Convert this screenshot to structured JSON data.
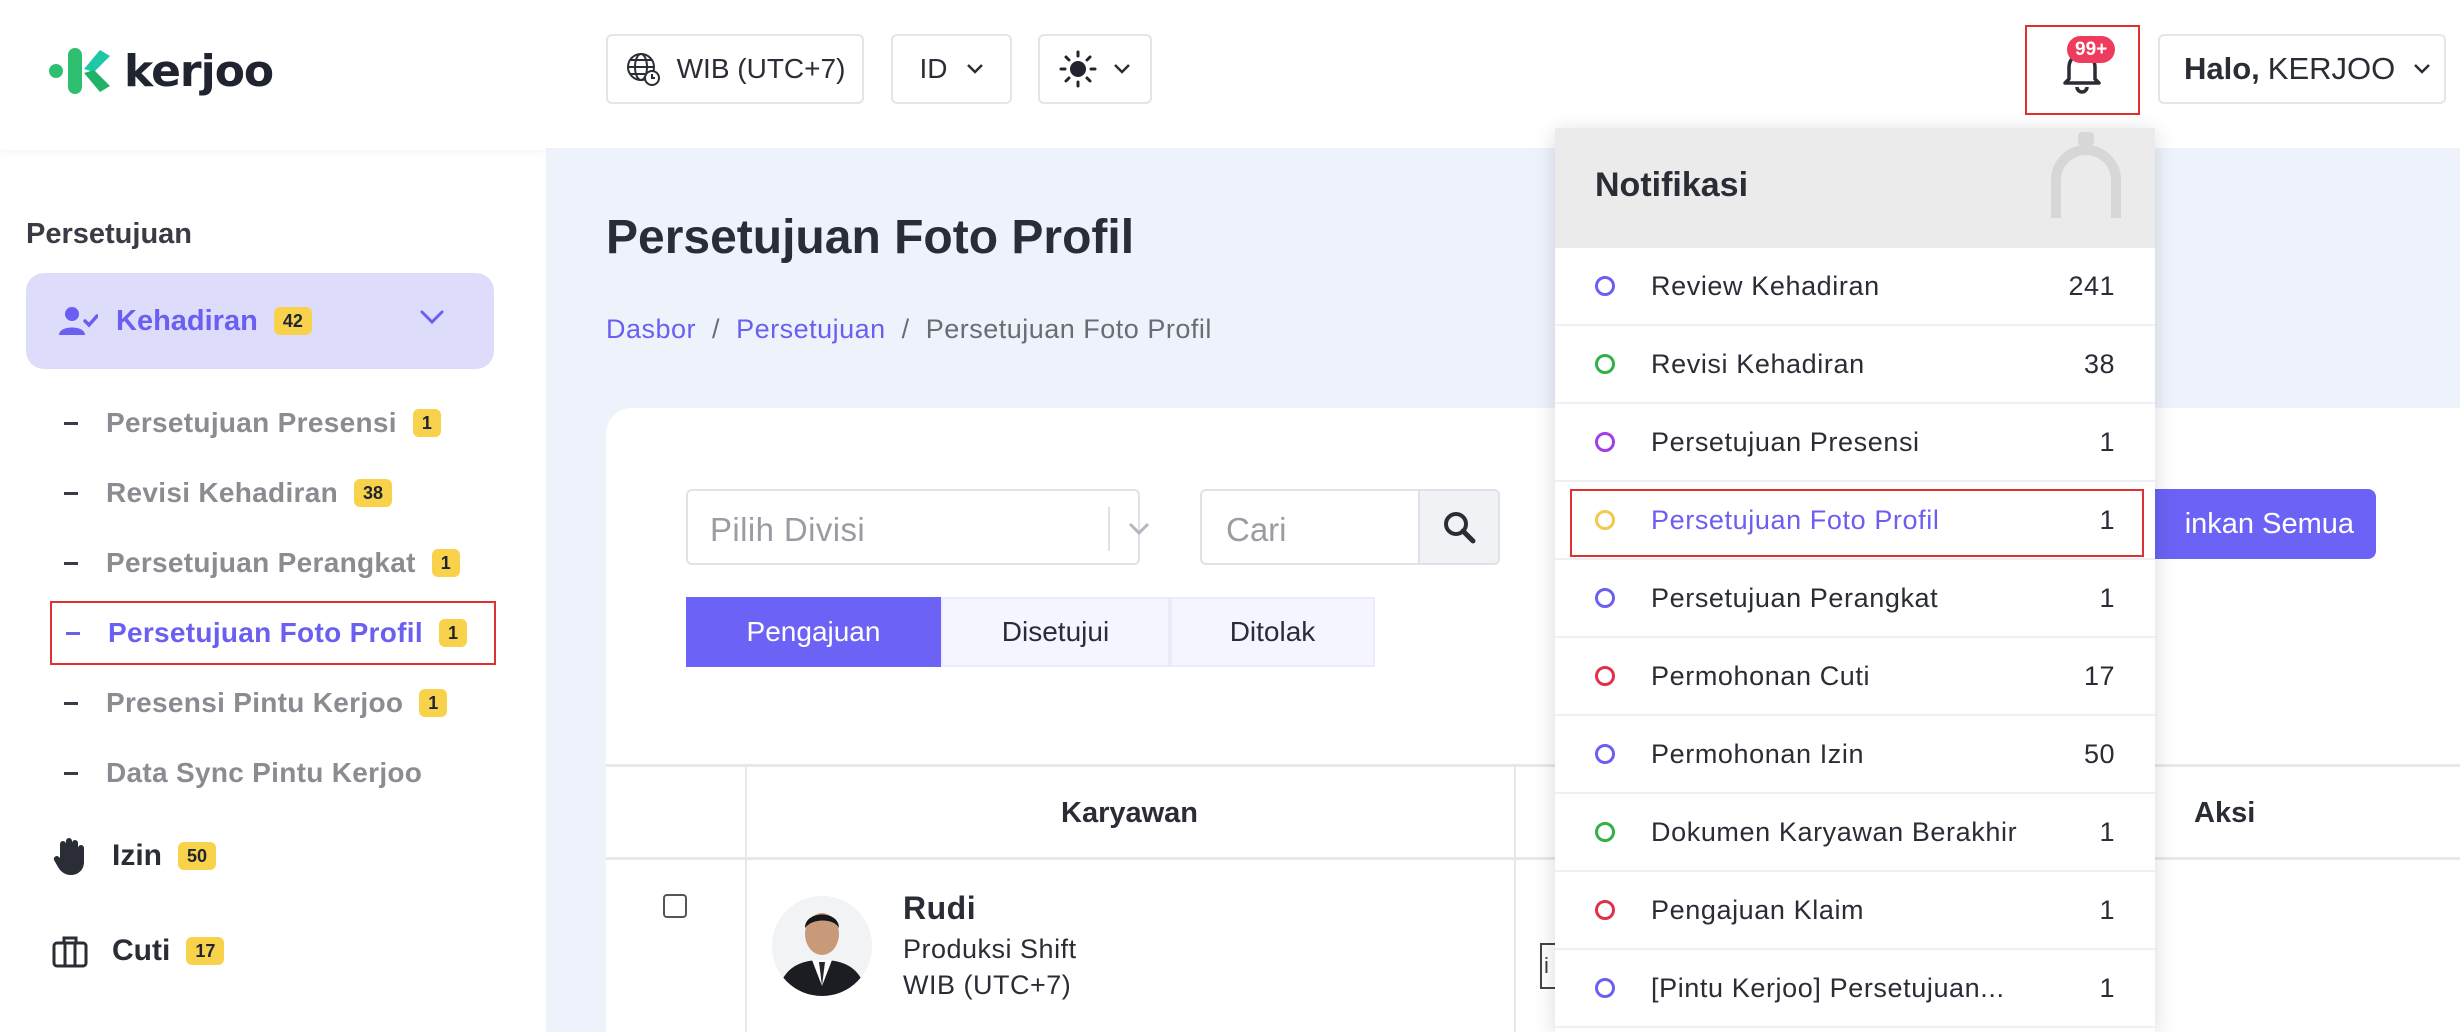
{
  "brand": {
    "name": "kerjoo"
  },
  "sidebar": {
    "section_title": "Persetujuan",
    "group": {
      "label": "Kehadiran",
      "badge": "42"
    },
    "subitems": [
      {
        "label": "Persetujuan Presensi",
        "badge": "1"
      },
      {
        "label": "Revisi Kehadiran",
        "badge": "38"
      },
      {
        "label": "Persetujuan Perangkat",
        "badge": "1"
      },
      {
        "label": "Persetujuan Foto Profil",
        "badge": "1"
      },
      {
        "label": "Presensi Pintu Kerjoo",
        "badge": "1"
      },
      {
        "label": "Data Sync Pintu Kerjoo",
        "badge": ""
      }
    ],
    "main_items": [
      {
        "label": "Izin",
        "badge": "50",
        "icon": "hand-icon"
      },
      {
        "label": "Cuti",
        "badge": "17",
        "icon": "briefcase-icon"
      }
    ]
  },
  "topbar": {
    "timezone": "WIB (UTC+7)",
    "language": "ID",
    "theme_icon": "sun-icon",
    "notification_count": "99+",
    "greeting": "Halo,",
    "user_name": "KERJOO"
  },
  "page": {
    "title": "Persetujuan Foto Profil",
    "breadcrumb": [
      "Dasbor",
      "Persetujuan",
      "Persetujuan Foto Profil"
    ]
  },
  "filters": {
    "division_placeholder": "Pilih Divisi",
    "search_placeholder": "Cari",
    "approve_all_label": "inkan Semua"
  },
  "tabs": [
    "Pengajuan",
    "Disetujui",
    "Ditolak"
  ],
  "table": {
    "headers": {
      "employee": "Karyawan",
      "action": "Aksi"
    },
    "rows": [
      {
        "name": "Rudi",
        "division": "Produksi Shift",
        "timezone": "WIB (UTC+7)",
        "partial_text": "i"
      }
    ]
  },
  "notifications": {
    "title": "Notifikasi",
    "items": [
      {
        "label": "Review Kehadiran",
        "count": "241",
        "color": "#6a5ff0"
      },
      {
        "label": "Revisi Kehadiran",
        "count": "38",
        "color": "#2fb344"
      },
      {
        "label": "Persetujuan Presensi",
        "count": "1",
        "color": "#a23ee8"
      },
      {
        "label": "Persetujuan Foto Profil",
        "count": "1",
        "color": "#f2c94c"
      },
      {
        "label": "Persetujuan Perangkat",
        "count": "1",
        "color": "#6a5ff0"
      },
      {
        "label": "Permohonan Cuti",
        "count": "17",
        "color": "#e0314b"
      },
      {
        "label": "Permohonan Izin",
        "count": "50",
        "color": "#6a5ff0"
      },
      {
        "label": "Dokumen Karyawan Berakhir",
        "count": "1",
        "color": "#2fb344"
      },
      {
        "label": "Pengajuan Klaim",
        "count": "1",
        "color": "#e0314b"
      },
      {
        "label": "[Pintu Kerjoo] Persetujuan...",
        "count": "1",
        "color": "#6a5ff0"
      }
    ]
  }
}
